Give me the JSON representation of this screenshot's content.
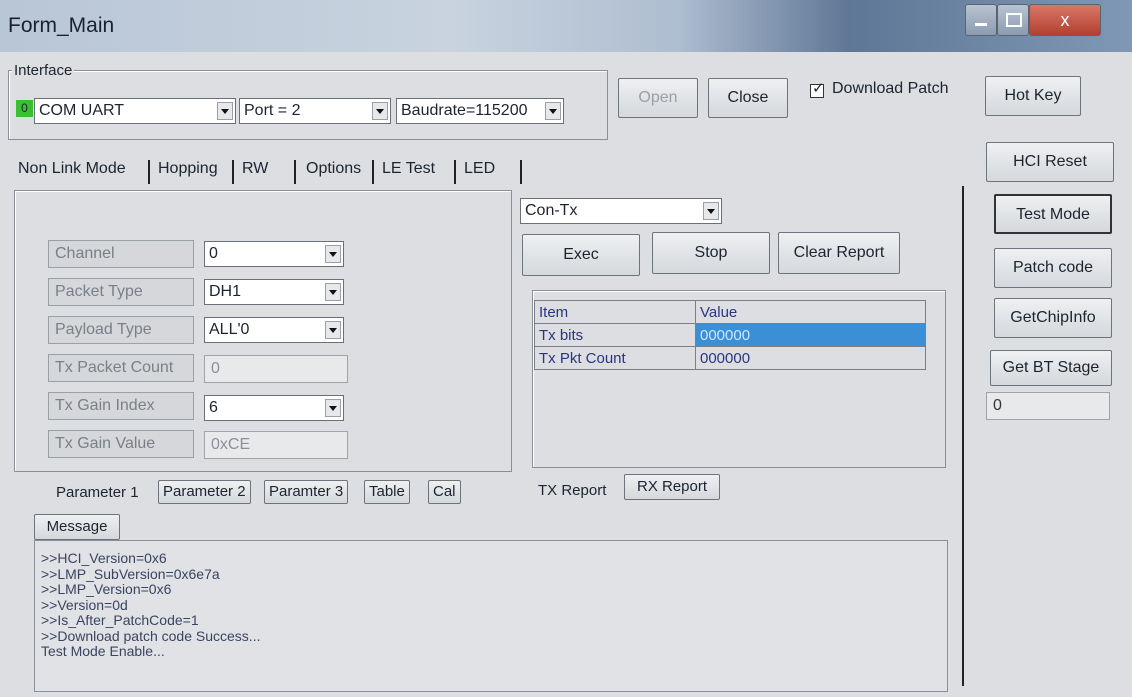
{
  "window": {
    "title": "Form_Main",
    "close_glyph": "x"
  },
  "interface": {
    "legend": "Interface",
    "status_led": "0",
    "port_type": "COM UART",
    "port": "Port = 2",
    "baudrate": "Baudrate=115200"
  },
  "top_buttons": {
    "open": "Open",
    "close": "Close",
    "download_patch": "Download Patch",
    "hot_key": "Hot Key"
  },
  "tabs": [
    "Non Link Mode",
    "Hopping",
    "RW",
    "Options",
    "LE Test",
    "LED"
  ],
  "params": {
    "channel_label": "Channel",
    "channel_value": "0",
    "packet_type_label": "Packet Type",
    "packet_type_value": "DH1",
    "payload_type_label": "Payload Type",
    "payload_type_value": "ALL'0",
    "tx_packet_count_label": "Tx Packet Count",
    "tx_packet_count_value": "0",
    "tx_gain_index_label": "Tx Gain Index",
    "tx_gain_index_value": "6",
    "tx_gain_value_label": "Tx Gain Value",
    "tx_gain_value_value": "0xCE"
  },
  "param_tabs": [
    "Parameter 1",
    "Parameter 2",
    "Paramter 3",
    "Table",
    "Cal"
  ],
  "test": {
    "mode": "Con-Tx",
    "exec": "Exec",
    "stop": "Stop",
    "clear_report": "Clear Report"
  },
  "report": {
    "headers": [
      "Item",
      "Value"
    ],
    "rows": [
      {
        "item": "Tx bits",
        "value": "000000"
      },
      {
        "item": "Tx Pkt Count",
        "value": "000000"
      }
    ],
    "tabs": [
      "TX Report",
      "RX Report"
    ]
  },
  "side_buttons": [
    "HCI Reset",
    "Test Mode",
    "Patch code",
    "GetChipInfo",
    "Get BT Stage"
  ],
  "bt_stage_value": "0",
  "message": {
    "tab": "Message",
    "lines": [
      ">>HCI_Version=0x6",
      ">>LMP_SubVersion=0x6e7a",
      ">>LMP_Version=0x6",
      ">>Version=0d",
      ">>Is_After_PatchCode=1",
      ">>Download patch code  Success...",
      "Test Mode Enable..."
    ]
  },
  "colors": {
    "selection": "#3b8fd6",
    "led_green": "#38c030",
    "close_red": "#c24a3a"
  }
}
